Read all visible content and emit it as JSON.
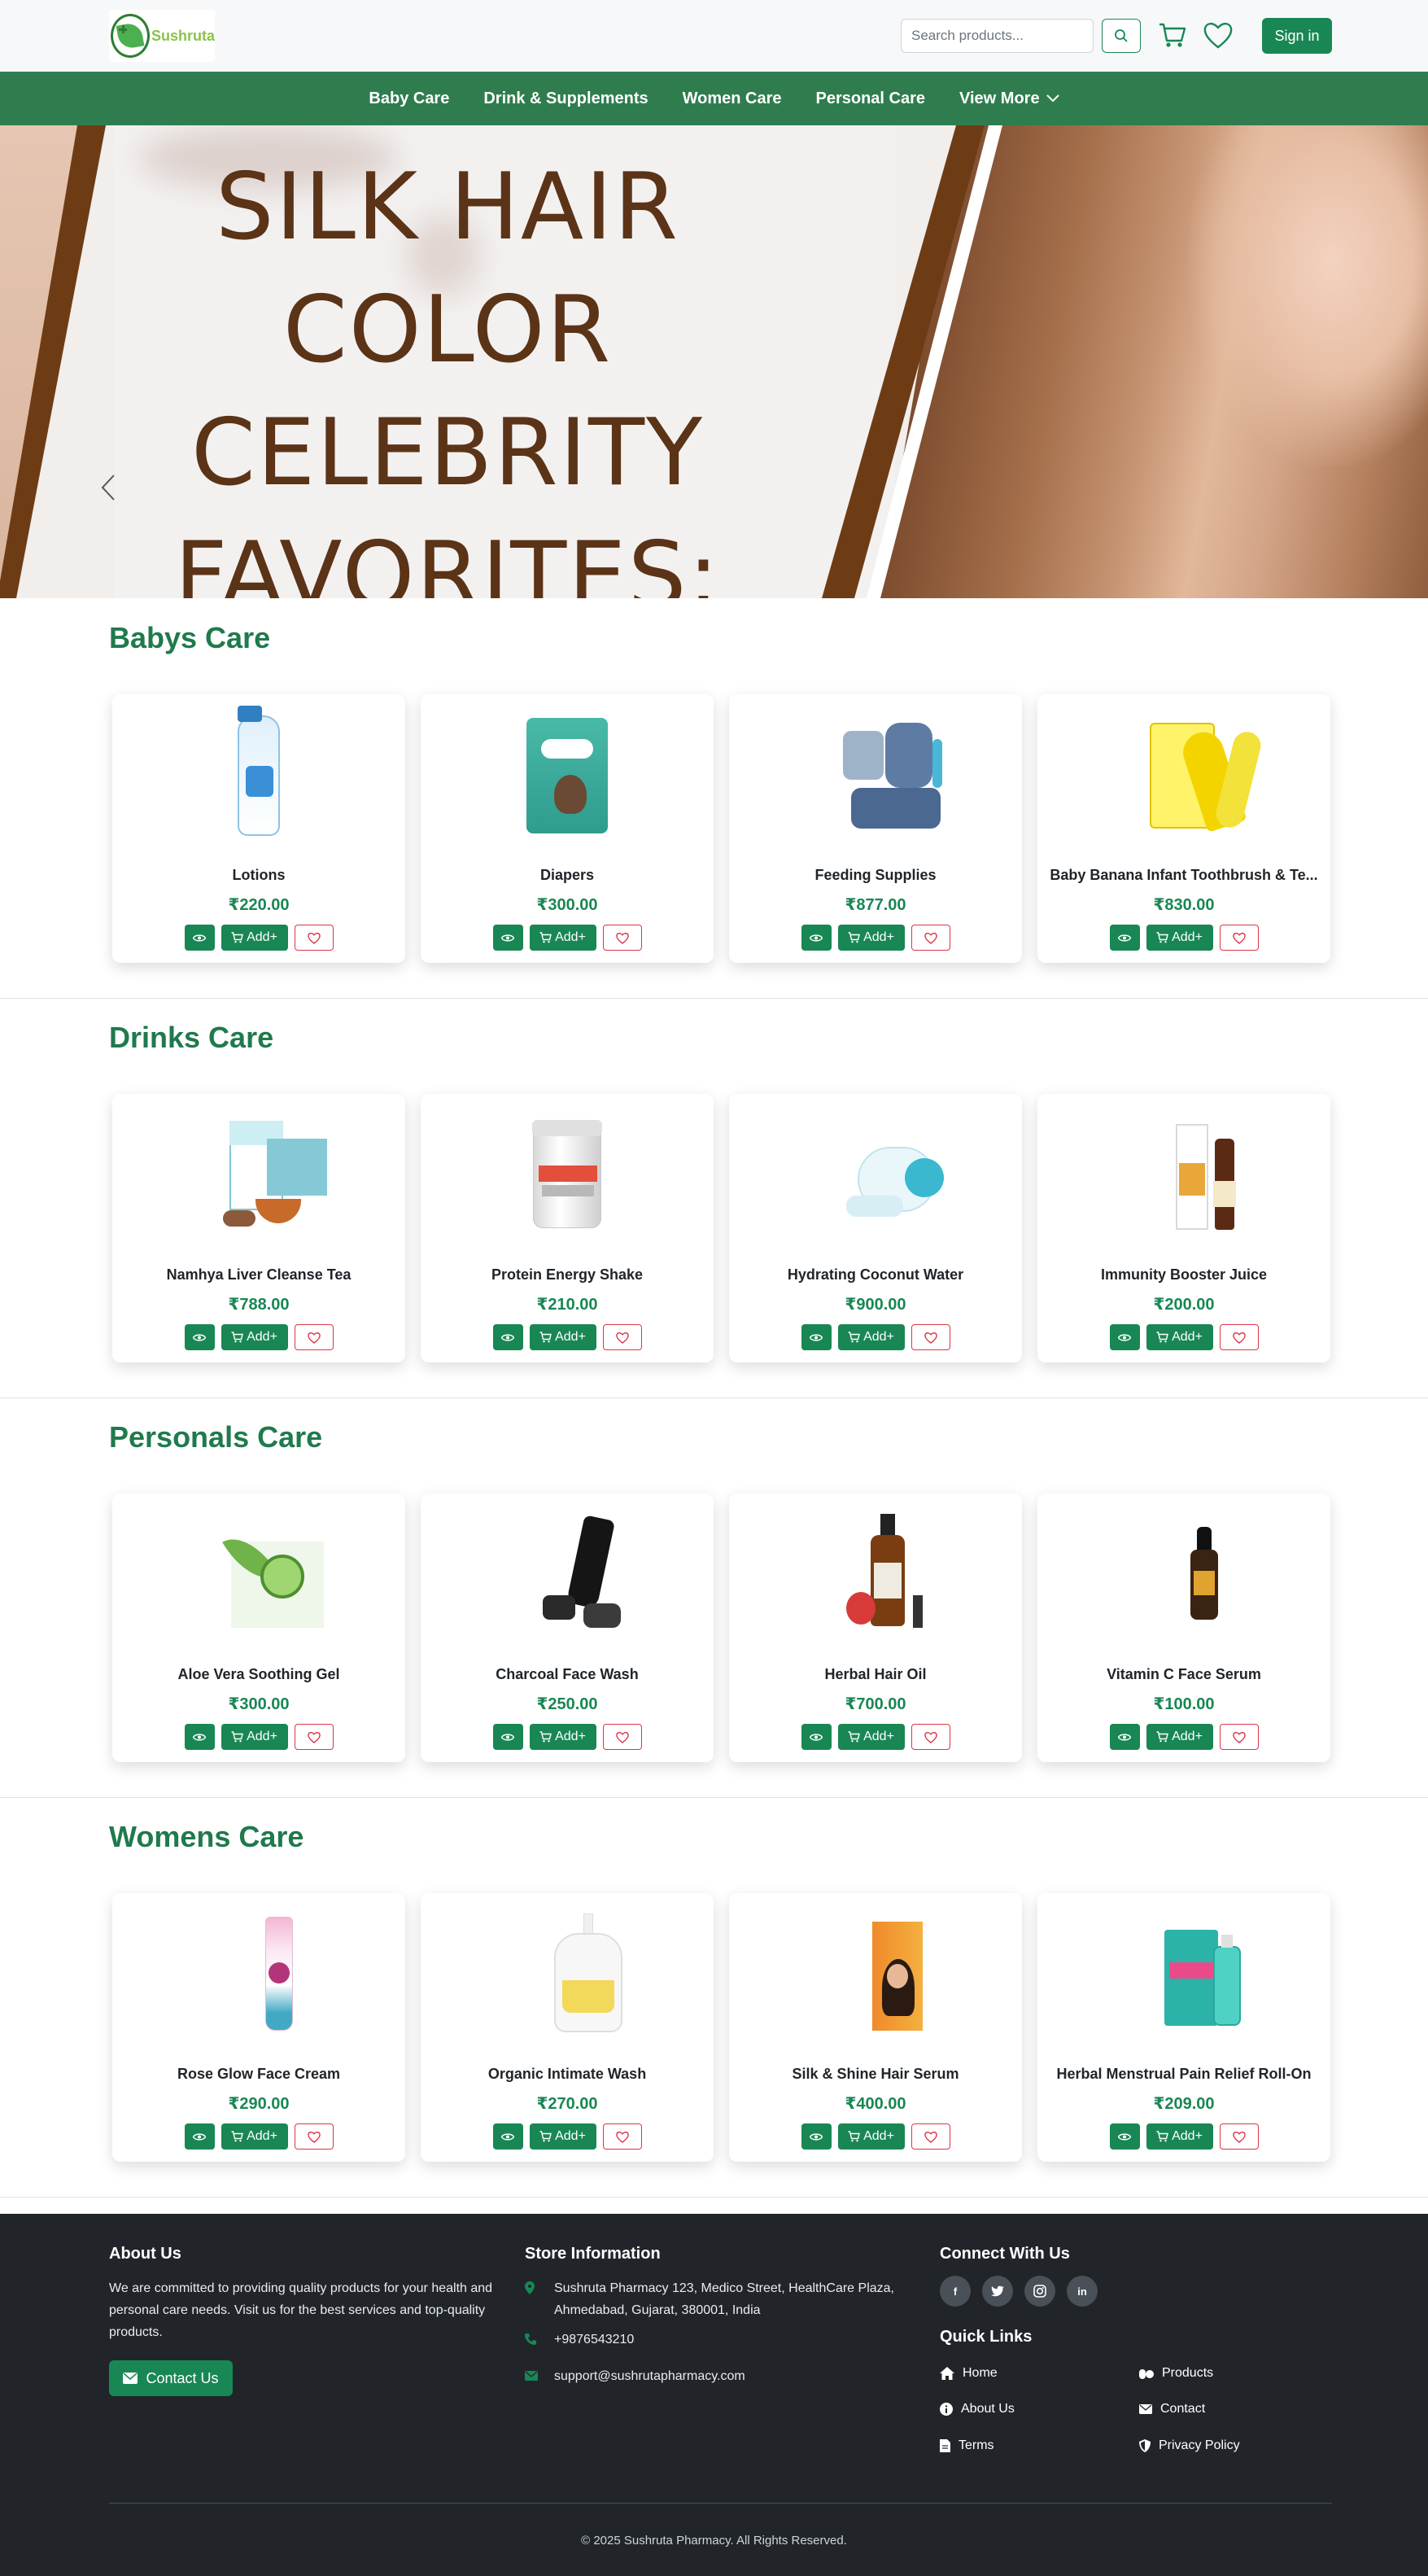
{
  "brand": {
    "name": "Sushruta"
  },
  "header": {
    "search_placeholder": "Search products...",
    "signin_label": "Sign in"
  },
  "nav": {
    "items": [
      "Baby Care",
      "Drink & Supplements",
      "Women Care",
      "Personal Care"
    ],
    "more_label": "View More"
  },
  "hero": {
    "lines": [
      "SILK HAIR",
      "COLOR",
      "CELEBRITY",
      "FAVORITES:"
    ]
  },
  "sections": [
    {
      "title": "Babys Care",
      "products": [
        {
          "name": "Lotions",
          "price": "₹220.00"
        },
        {
          "name": "Diapers",
          "price": "₹300.00"
        },
        {
          "name": "Feeding Supplies",
          "price": "₹877.00"
        },
        {
          "name": "Baby Banana Infant Toothbrush & Te...",
          "price": "₹830.00"
        }
      ]
    },
    {
      "title": "Drinks Care",
      "products": [
        {
          "name": "Namhya Liver Cleanse Tea",
          "price": "₹788.00"
        },
        {
          "name": "Protein Energy Shake",
          "price": "₹210.00"
        },
        {
          "name": "Hydrating Coconut Water",
          "price": "₹900.00"
        },
        {
          "name": "Immunity Booster Juice",
          "price": "₹200.00"
        }
      ]
    },
    {
      "title": "Personals Care",
      "products": [
        {
          "name": "Aloe Vera Soothing Gel",
          "price": "₹300.00"
        },
        {
          "name": "Charcoal Face Wash",
          "price": "₹250.00"
        },
        {
          "name": "Herbal Hair Oil",
          "price": "₹700.00"
        },
        {
          "name": "Vitamin C Face Serum",
          "price": "₹100.00"
        }
      ]
    },
    {
      "title": "Womens Care",
      "products": [
        {
          "name": "Rose Glow Face Cream",
          "price": "₹290.00"
        },
        {
          "name": "Organic Intimate Wash",
          "price": "₹270.00"
        },
        {
          "name": "Silk & Shine Hair Serum",
          "price": "₹400.00"
        },
        {
          "name": "Herbal Menstrual Pain Relief Roll-On",
          "price": "₹209.00"
        }
      ]
    }
  ],
  "card_actions": {
    "add_label": "Add+"
  },
  "footer": {
    "about": {
      "title": "About Us",
      "text": "We are committed to providing quality products for your health and personal care needs. Visit us for the best services and top-quality products.",
      "button": "Contact Us"
    },
    "store": {
      "title": "Store Information",
      "address": "Sushruta Pharmacy 123, Medico Street, HealthCare Plaza, Ahmedabad, Gujarat, 380001, India",
      "phone": "+9876543210",
      "email": "support@sushrutapharmacy.com"
    },
    "connect": {
      "title": "Connect With Us",
      "social": [
        "facebook",
        "twitter",
        "instagram",
        "linkedin"
      ]
    },
    "quick_links": {
      "title": "Quick Links",
      "items": [
        "Home",
        "Products",
        "About Us",
        "Contact",
        "Terms",
        "Privacy Policy"
      ]
    },
    "copyright": "© 2025 Sushruta Pharmacy. All Rights Reserved."
  },
  "colors": {
    "primary": "#198754",
    "nav": "#2f7d4f",
    "footer": "#212529",
    "hero_text": "#5b3317"
  }
}
